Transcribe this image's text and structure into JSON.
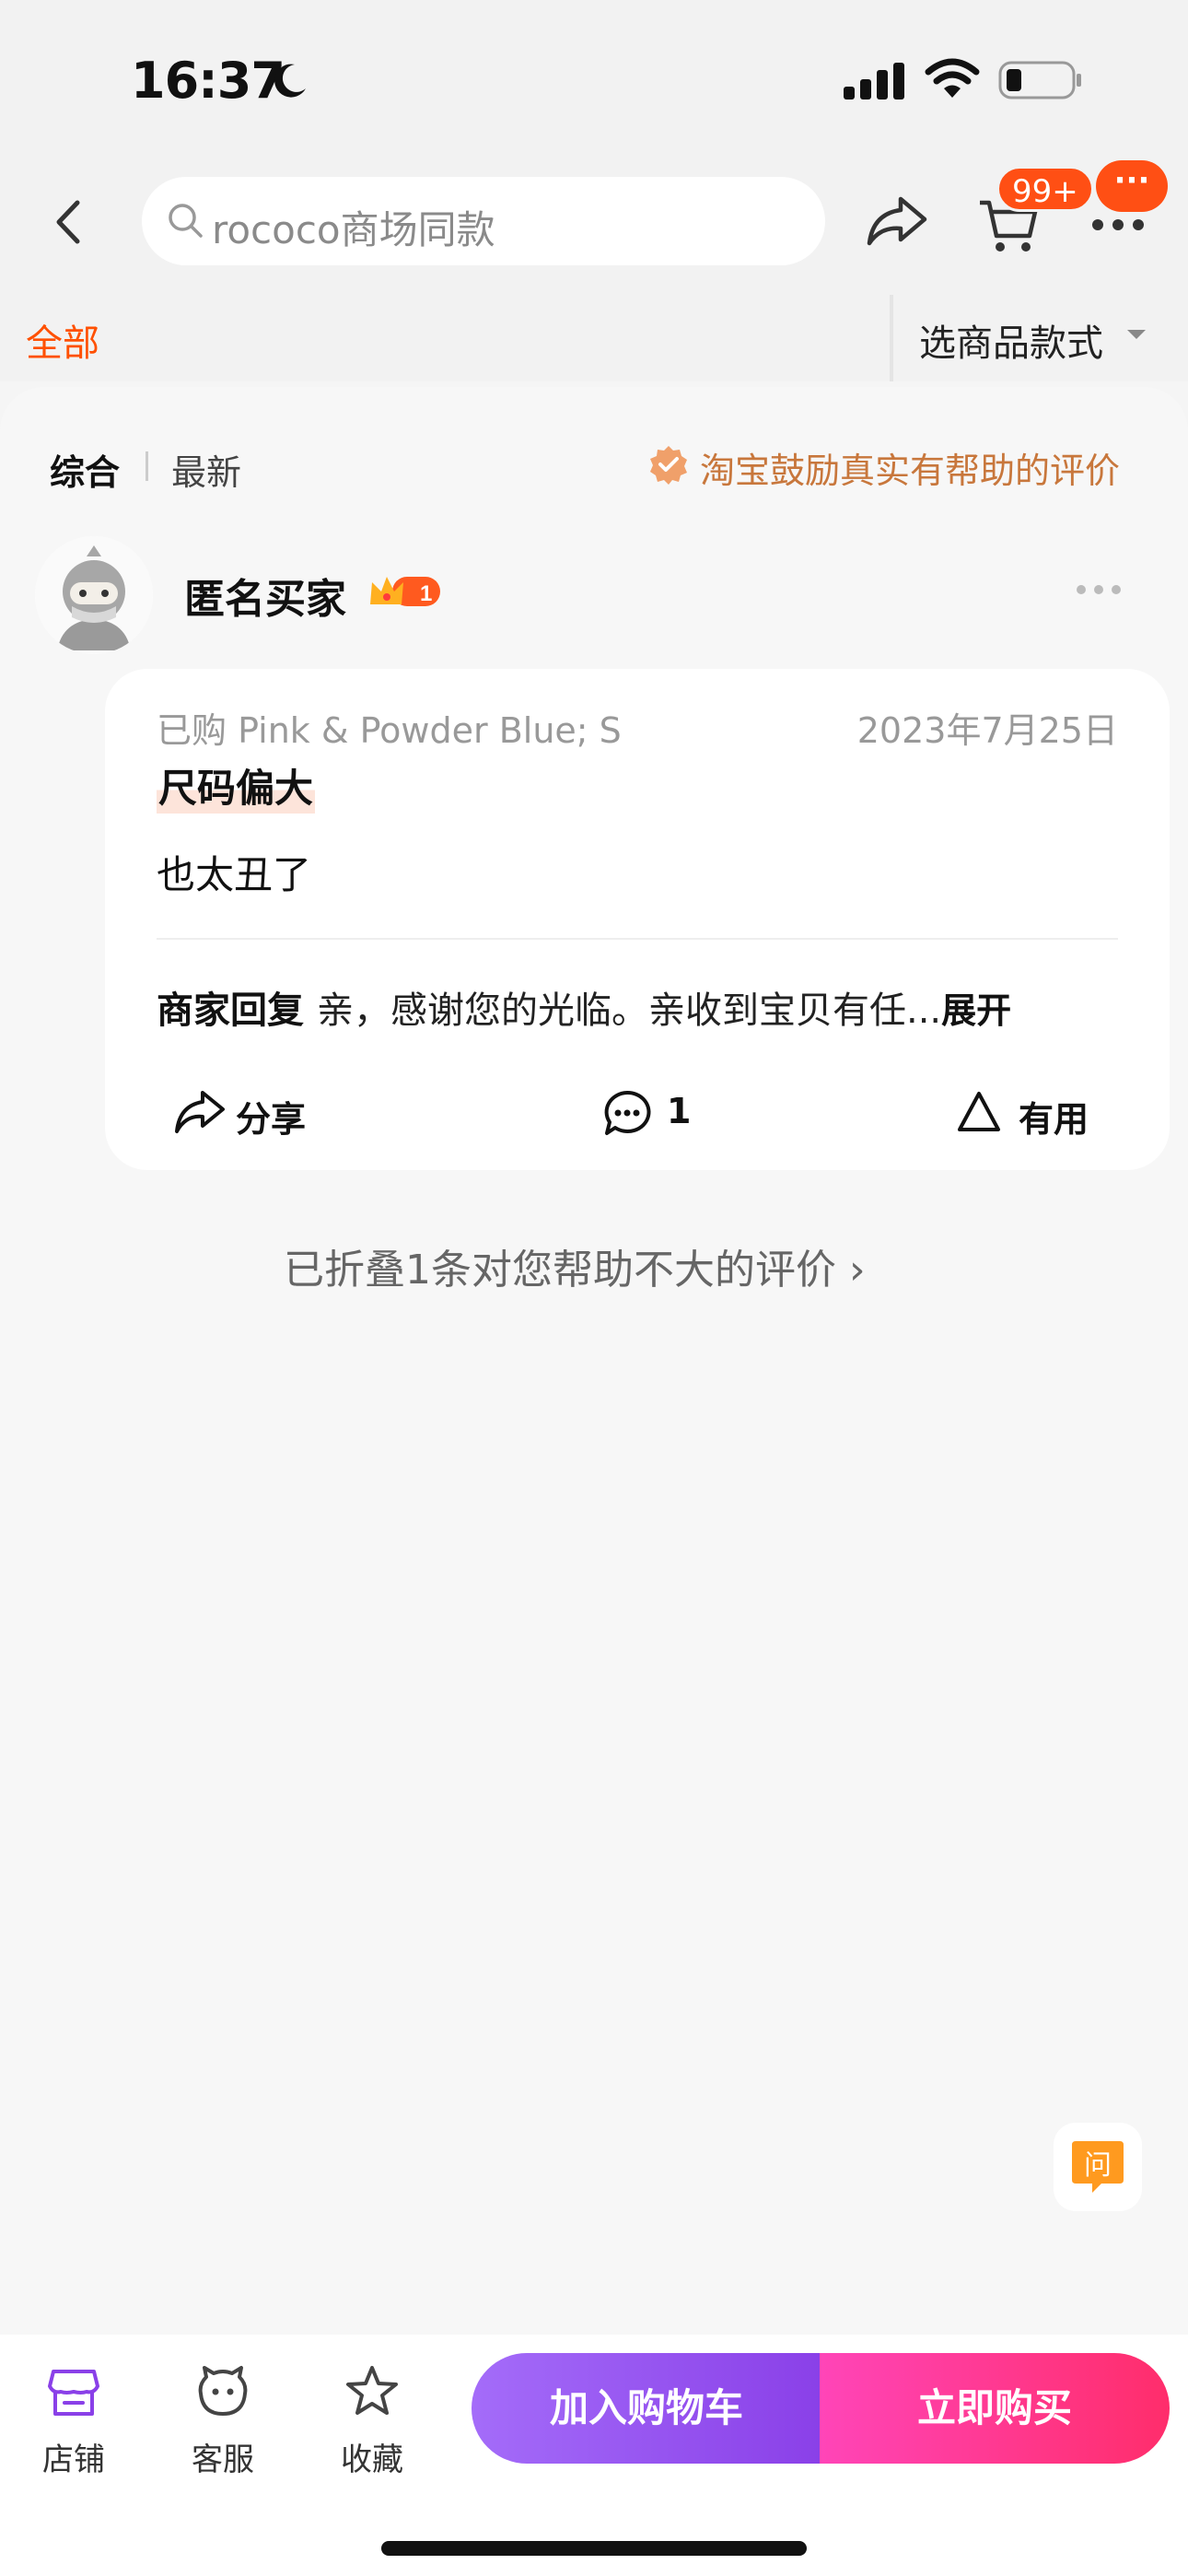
{
  "status_bar": {
    "time": "16:37"
  },
  "nav": {
    "search_placeholder": "rococo商场同款",
    "cart_badge": "99+",
    "message_dots": "···"
  },
  "filter": {
    "all_label": "全部",
    "style_label": "选商品款式"
  },
  "sort": {
    "comprehensive": "综合",
    "newest": "最新",
    "encourage_text": "淘宝鼓励真实有帮助的评价"
  },
  "review": {
    "reviewer": "匿名买家",
    "level": "1",
    "purchased": "已购 Pink & Powder Blue; S",
    "date": "2023年7月25日",
    "tag": "尺码偏大",
    "text": "也太丑了",
    "merchant_label": "商家回复",
    "merchant_reply": "亲，感谢您的光临。亲收到宝贝有任...",
    "expand": "展开",
    "share_label": "分享",
    "comment_count": "1",
    "useful_label": "有用"
  },
  "folded": "已折叠1条对您帮助不大的评价 ›",
  "ask_label": "问",
  "bottom": {
    "store": "店铺",
    "service": "客服",
    "favorite": "收藏",
    "add_cart": "加入购物车",
    "buy_now": "立即购买"
  },
  "colors": {
    "accent": "#ff5000",
    "purple": "#8a40e8",
    "pink": "#ff2d6b",
    "encourage": "#c8773c"
  }
}
